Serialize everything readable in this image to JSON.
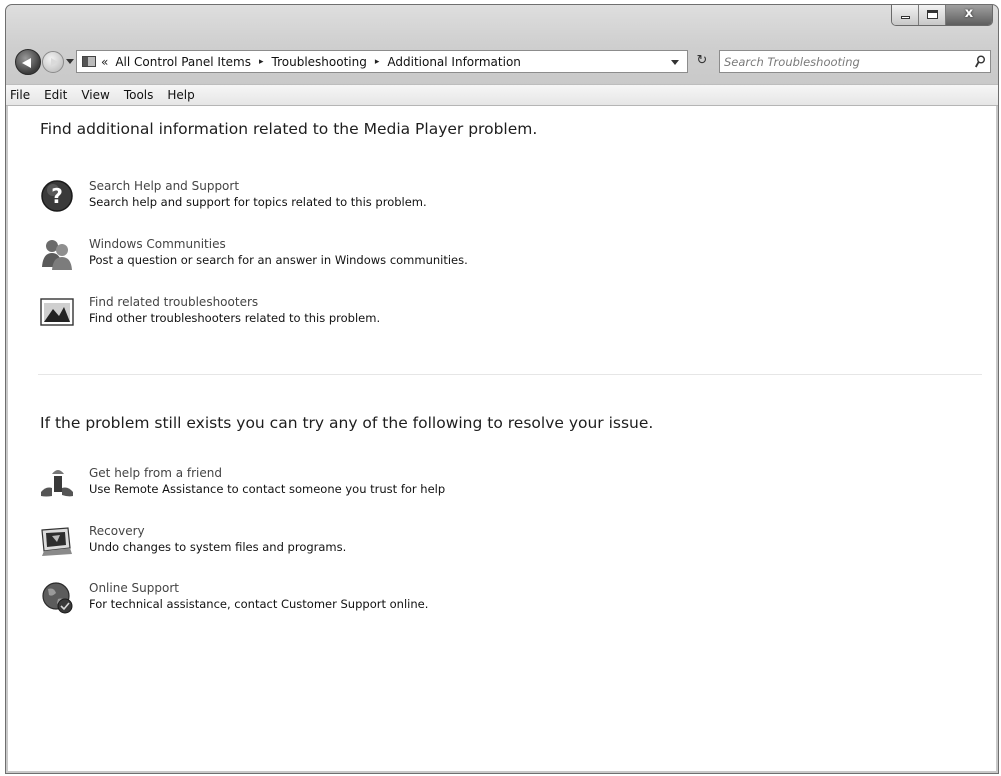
{
  "window": {
    "caption_buttons": {
      "minimize": "minimize-icon",
      "maximize": "maximize-icon",
      "close_glyph": "x"
    }
  },
  "navigation": {
    "breadcrumb_prefix": "«",
    "breadcrumbs": [
      "All Control Panel Items",
      "Troubleshooting",
      "Additional Information"
    ],
    "separator": "▸",
    "refresh_glyph": "↻",
    "search_placeholder": "Search Troubleshooting"
  },
  "menu": {
    "items": [
      "File",
      "Edit",
      "View",
      "Tools",
      "Help"
    ]
  },
  "section1": {
    "heading": "Find additional information related to the Media Player problem.",
    "items": [
      {
        "title": "Search Help and Support",
        "description": "Search help and support for topics related to this problem.",
        "icon": "help-question-icon"
      },
      {
        "title": "Windows Communities",
        "description": "Post a question or search for an answer in Windows communities.",
        "icon": "community-users-icon"
      },
      {
        "title": "Find related troubleshooters",
        "description": "Find other troubleshooters related to this problem.",
        "icon": "troubleshooter-icon"
      }
    ]
  },
  "section2": {
    "heading": "If the problem still exists you can try any of the following to resolve your issue.",
    "items": [
      {
        "title": "Get help from a friend",
        "description": "Use Remote Assistance to contact someone you trust for help",
        "icon": "remote-assistance-icon"
      },
      {
        "title": "Recovery",
        "description": "Undo changes to system files and programs.",
        "icon": "recovery-icon"
      },
      {
        "title": "Online Support",
        "description": "For technical assistance, contact Customer Support online.",
        "icon": "online-support-globe-icon"
      }
    ]
  }
}
